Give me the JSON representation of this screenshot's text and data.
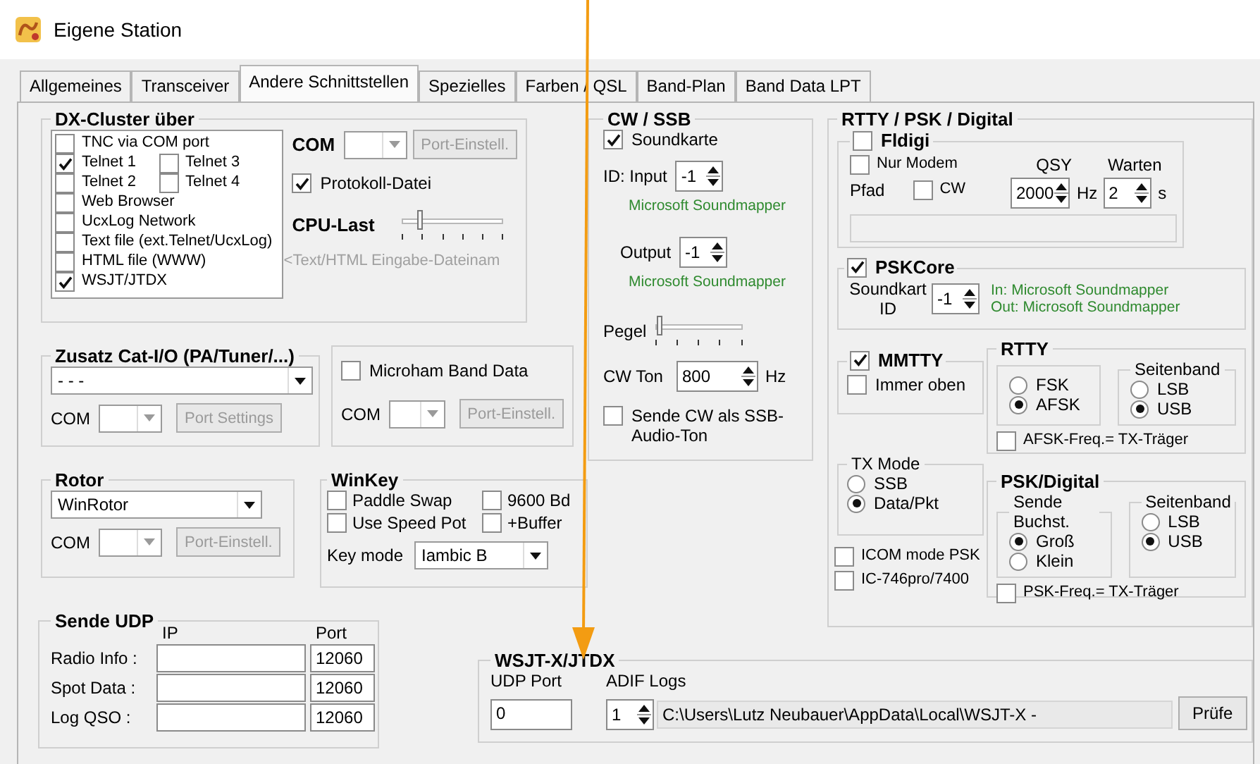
{
  "window": {
    "title": "Eigene Station"
  },
  "tabs": [
    {
      "label": "Allgemeines",
      "selected": false
    },
    {
      "label": "Transceiver",
      "selected": false
    },
    {
      "label": "Andere Schnittstellen",
      "selected": true
    },
    {
      "label": "Spezielles",
      "selected": false
    },
    {
      "label": "Farben / QSL",
      "selected": false
    },
    {
      "label": "Band-Plan",
      "selected": false
    },
    {
      "label": "Band Data LPT",
      "selected": false
    }
  ],
  "dx_cluster": {
    "title": "DX-Cluster über",
    "source_rows": [
      [
        {
          "label": "TNC via COM port",
          "checked": false
        }
      ],
      [
        {
          "label": "Telnet 1",
          "checked": true
        },
        {
          "label": "Telnet 3",
          "checked": false
        }
      ],
      [
        {
          "label": "Telnet 2",
          "checked": false
        },
        {
          "label": "Telnet 4",
          "checked": false
        }
      ],
      [
        {
          "label": "Web Browser",
          "checked": false
        }
      ],
      [
        {
          "label": "UcxLog Network",
          "checked": false
        }
      ],
      [
        {
          "label": "Text file (ext.Telnet/UcxLog)",
          "checked": false
        }
      ],
      [
        {
          "label": "HTML file (WWW)",
          "checked": false
        }
      ],
      [
        {
          "label": "WSJT/JTDX",
          "checked": true
        }
      ]
    ],
    "com_label": "COM",
    "com": {
      "disabled": true
    },
    "port_button": {
      "label": "Port-Einstell.",
      "disabled": true
    },
    "log_file": {
      "label": "Protokoll-Datei",
      "checked": true
    },
    "cpu_load": {
      "label": "CPU-Last",
      "level": 0.15
    },
    "file_hint": "<Text/HTML Eingabe-Dateinam"
  },
  "zusatz": {
    "title": "Zusatz Cat-I/O (PA/Tuner/...)",
    "device": "- - -",
    "com_label": "COM",
    "com": {
      "disabled": true
    },
    "port_button": {
      "label": "Port Settings",
      "disabled": true
    }
  },
  "microham": {
    "checkbox": {
      "label": "Microham Band Data",
      "checked": false
    },
    "com_label": "COM",
    "com": {
      "disabled": true
    },
    "port_button": {
      "label": "Port-Einstell.",
      "disabled": true
    }
  },
  "rotor": {
    "title": "Rotor",
    "device": "WinRotor",
    "com_label": "COM",
    "com": {
      "disabled": true
    },
    "port_button": {
      "label": "Port-Einstell.",
      "disabled": true
    }
  },
  "winkey": {
    "title": "WinKey",
    "options": [
      {
        "label": "Paddle Swap",
        "checked": false
      },
      {
        "label": "9600 Bd",
        "checked": false
      },
      {
        "label": "Use Speed Pot",
        "checked": false
      },
      {
        "label": "+Buffer",
        "checked": false
      }
    ],
    "key_mode_label": "Key mode",
    "key_mode": "Iambic B"
  },
  "send_udp": {
    "title": "Sende UDP",
    "ip_header": "IP",
    "port_header": "Port",
    "rows": [
      {
        "label": "Radio Info :",
        "port": "12060"
      },
      {
        "label": "Spot Data :",
        "port": "12060"
      },
      {
        "label": "Log QSO :",
        "port": "12060"
      }
    ]
  },
  "cw_ssb": {
    "title": "CW / SSB",
    "soundcard": {
      "label": "Soundkarte",
      "checked": true
    },
    "input": {
      "label": "ID: Input",
      "value": "-1",
      "device": "Microsoft Soundmapper"
    },
    "output": {
      "label": "Output",
      "value": "-1",
      "device": "Microsoft Soundmapper"
    },
    "gain": {
      "label": "Pegel",
      "level": 0.02
    },
    "cw_tone": {
      "label": "CW Ton",
      "value": "800",
      "unit": "Hz"
    },
    "cw_as_audio": {
      "label": "Sende CW als SSB-Audio-Ton",
      "checked": false
    }
  },
  "digital": {
    "title": "RTTY / PSK / Digital",
    "fldigi": {
      "label": "Fldigi",
      "checked": false,
      "modem_only": {
        "label": "Nur Modem",
        "checked": false
      },
      "cw": {
        "label": "CW",
        "checked": false
      },
      "qsy_label": "QSY",
      "qsy": "2000",
      "qsy_unit": "Hz",
      "wait_label": "Warten",
      "wait": "2",
      "wait_unit": "s",
      "path_label": "Pfad"
    },
    "pskcore": {
      "label": "PSKCore",
      "checked": true,
      "soundcard_label": "Soundkart ID",
      "value": "-1",
      "in": "In: Microsoft Soundmapper",
      "out": "Out: Microsoft Soundmapper"
    },
    "mmtty": {
      "label": "MMTTY",
      "checked": true,
      "always_on_top": {
        "label": "Immer oben",
        "checked": false
      }
    },
    "rtty": {
      "title": "RTTY",
      "modes": [
        {
          "label": "FSK",
          "selected": false
        },
        {
          "label": "AFSK",
          "selected": true
        }
      ],
      "sideband_title": "Seitenband",
      "sidebands": [
        {
          "label": "LSB",
          "selected": false
        },
        {
          "label": "USB",
          "selected": true
        }
      ],
      "carrier": {
        "label": "AFSK-Freq.= TX-Träger",
        "checked": false
      }
    },
    "tx_mode": {
      "title": "TX Mode",
      "options": [
        {
          "label": "SSB",
          "selected": false
        },
        {
          "label": "Data/Pkt",
          "selected": true
        }
      ]
    },
    "icom": [
      {
        "label": "ICOM mode PSK",
        "checked": false
      },
      {
        "label": "IC-746pro/7400",
        "checked": false
      }
    ],
    "psk": {
      "title": "PSK/Digital",
      "letters_title": "Sende Buchst.",
      "letters": [
        {
          "label": "Groß",
          "selected": true
        },
        {
          "label": "Klein",
          "selected": false
        }
      ],
      "sideband_title": "Seitenband",
      "sidebands": [
        {
          "label": "LSB",
          "selected": false
        },
        {
          "label": "USB",
          "selected": true
        }
      ],
      "carrier": {
        "label": "PSK-Freq.= TX-Träger",
        "checked": false
      }
    }
  },
  "wsjt": {
    "title": "WSJT-X/JTDX",
    "udp_port_label": "UDP Port",
    "udp_port": "0",
    "adif_label": "ADIF Logs",
    "adif_index": "1",
    "adif_path": "C:\\Users\\Lutz Neubauer\\AppData\\Local\\WSJT-X -",
    "check_button": {
      "label": "Prüfe",
      "disabled": false
    }
  }
}
